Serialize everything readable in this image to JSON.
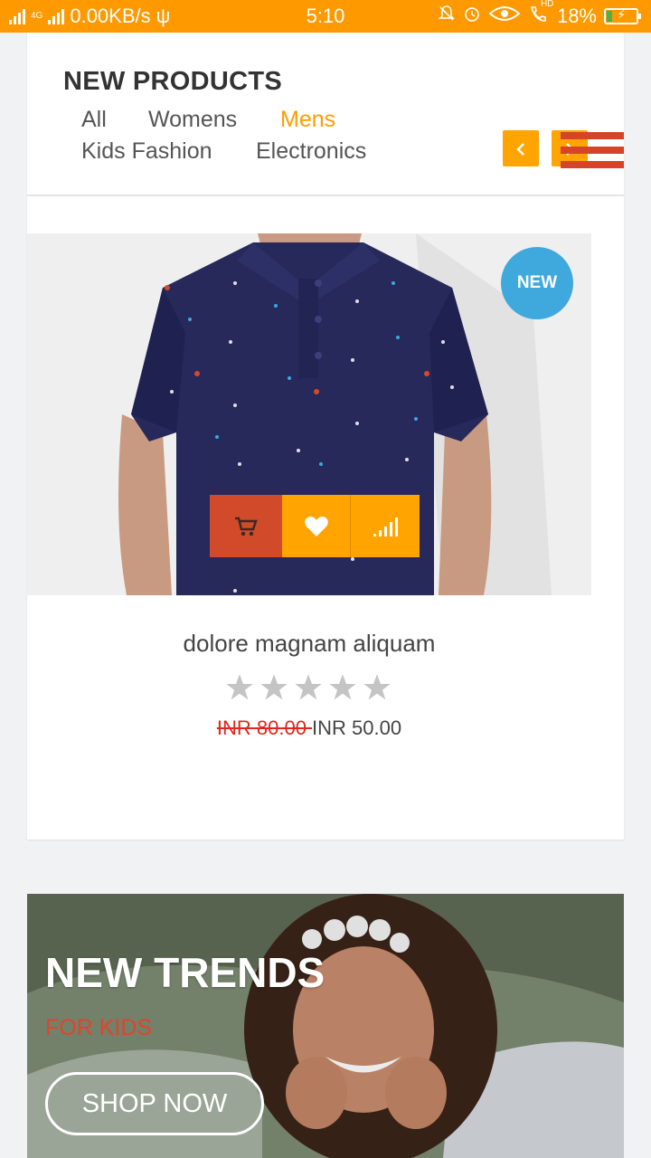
{
  "status_bar": {
    "network": "4G",
    "speed": "0.00KB/s",
    "time": "5:10",
    "hd": "HD",
    "battery": "18%"
  },
  "product_section": {
    "title": "NEW PRODUCTS",
    "tabs": [
      "All",
      "Womens",
      "Mens",
      "Kids Fashion",
      "Electronics"
    ],
    "active_tab": "Mens",
    "prev_icon": "chevron-left-icon",
    "next_icon": "chevron-right-icon",
    "menu_icon": "hamburger-menu-icon"
  },
  "product": {
    "badge": "NEW",
    "name": "dolore magnam aliquam",
    "rating": 0,
    "rating_max": 5,
    "old_price": "INR 80.00 ",
    "price": "INR 50.00",
    "actions": [
      "cart-icon",
      "heart-icon",
      "compare-icon"
    ]
  },
  "banner": {
    "title": "NEW TRENDS",
    "subtitle": "FOR KIDS",
    "button": "SHOP NOW"
  },
  "colors": {
    "accent": "#ffa400",
    "active_tab": "#ff9c00",
    "cart_red": "#d14a2a",
    "badge_blue": "#3fa9dd",
    "old_price_red": "#e0261d"
  }
}
